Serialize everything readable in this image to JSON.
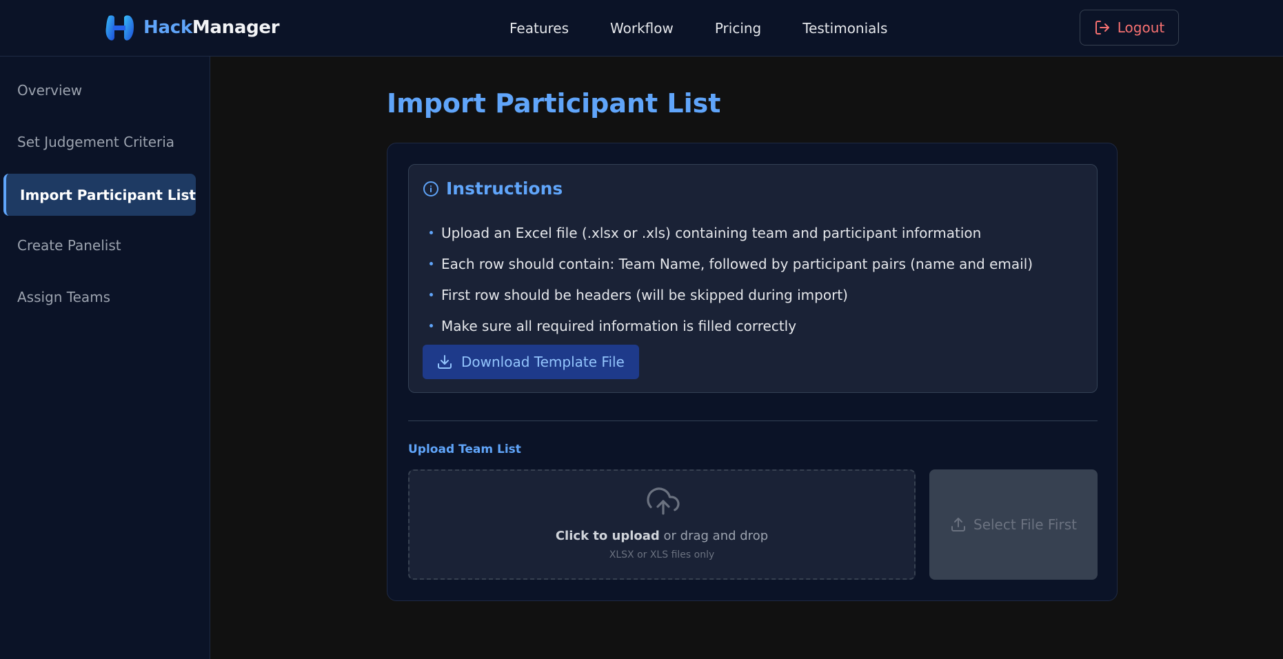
{
  "brand": {
    "name_part1": "Hack",
    "name_part2": "Manager",
    "logo_icon": "hackmanager-logo"
  },
  "nav": {
    "links": [
      "Features",
      "Workflow",
      "Pricing",
      "Testimonials"
    ],
    "logout_label": "Logout"
  },
  "sidebar": {
    "items": [
      {
        "label": "Overview",
        "active": false
      },
      {
        "label": "Set Judgement Criteria",
        "active": false
      },
      {
        "label": "Import Participant List",
        "active": true
      },
      {
        "label": "Create Panelist",
        "active": false
      },
      {
        "label": "Assign Teams",
        "active": false
      }
    ]
  },
  "main": {
    "title": "Import Participant List",
    "instructions": {
      "title": "Instructions",
      "icon": "info-icon",
      "items": [
        "Upload an Excel file (.xlsx or .xls) containing team and participant information",
        "Each row should contain: Team Name, followed by participant pairs (name and email)",
        "First row should be headers (will be skipped during import)",
        "Make sure all required information is filled correctly"
      ],
      "download_label": "Download Template File"
    },
    "upload": {
      "label": "Upload Team List",
      "click_text": "Click to upload",
      "drag_text": " or drag and drop",
      "hint": "XLSX or XLS files only",
      "select_label": "Select File First"
    }
  },
  "colors": {
    "accent": "#60a5fa",
    "danger": "#f87171",
    "background": "#111111",
    "panel": "#0b1327"
  }
}
